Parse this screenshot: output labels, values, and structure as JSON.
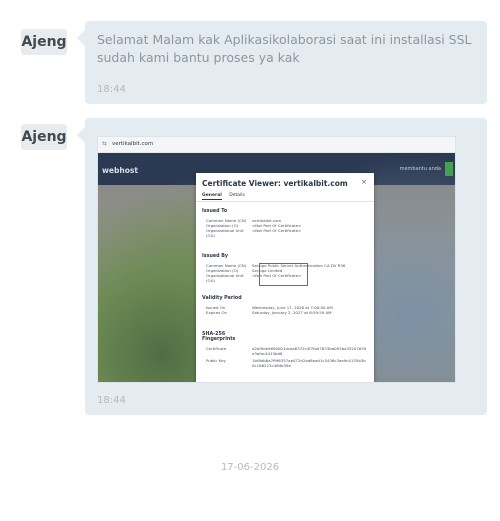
{
  "messages": [
    {
      "sender": "Ajeng",
      "text": "Selamat Malam kak Aplikasikolaborasi saat ini installasi SSL sudah kami bantu proses ya kak",
      "time": "18:44"
    },
    {
      "sender": "Ajeng",
      "time": "18:44",
      "attachment": {
        "tab_url": "vertikalbit.com",
        "site_brand": "webhost",
        "site_right_label": "membantu anda",
        "dialog": {
          "title": "Certificate Viewer: vertikalbit.com",
          "close": "×",
          "tabs": [
            "General",
            "Details"
          ],
          "sections": [
            {
              "title": "Issued To",
              "rows": [
                {
                  "k": "Common Name (CN)",
                  "v": "vertikalbit.com"
                },
                {
                  "k": "Organization (O)",
                  "v": "<Not Part Of Certificate>"
                },
                {
                  "k": "Organizational Unit (OU)",
                  "v": "<Not Part Of Certificate>"
                }
              ]
            },
            {
              "title": "Issued By",
              "rows": [
                {
                  "k": "Common Name (CN)",
                  "v": "Sectigo Public Server Authentication CA DV R36"
                },
                {
                  "k": "Organization (O)",
                  "v": "Sectigo Limited"
                },
                {
                  "k": "Organizational Unit (OU)",
                  "v": "<Not Part Of Certificate>"
                }
              ]
            },
            {
              "title": "Validity Period",
              "rows": [
                {
                  "k": "Issued On",
                  "v": "Wednesday, June 17, 2026 at 7:00:00 AM"
                },
                {
                  "k": "Expires On",
                  "v": "Saturday, January 2, 2027 at 6:59:59 AM"
                }
              ]
            },
            {
              "title": "SHA-256 Fingerprints",
              "rows": [
                {
                  "k": "Certificate",
                  "v": "d2af9de9690001dcaa6372c4f7fa07833bb093ba33207639e3afac4415bd8"
                },
                {
                  "k": "Public Key",
                  "v": "1bf8db6a7f9f6357ae072d2ad6ead1c5436c3ae9c4135b3b0c166223c48db39e"
                }
              ]
            }
          ]
        }
      }
    }
  ],
  "date_stamp": "17-06-2026"
}
